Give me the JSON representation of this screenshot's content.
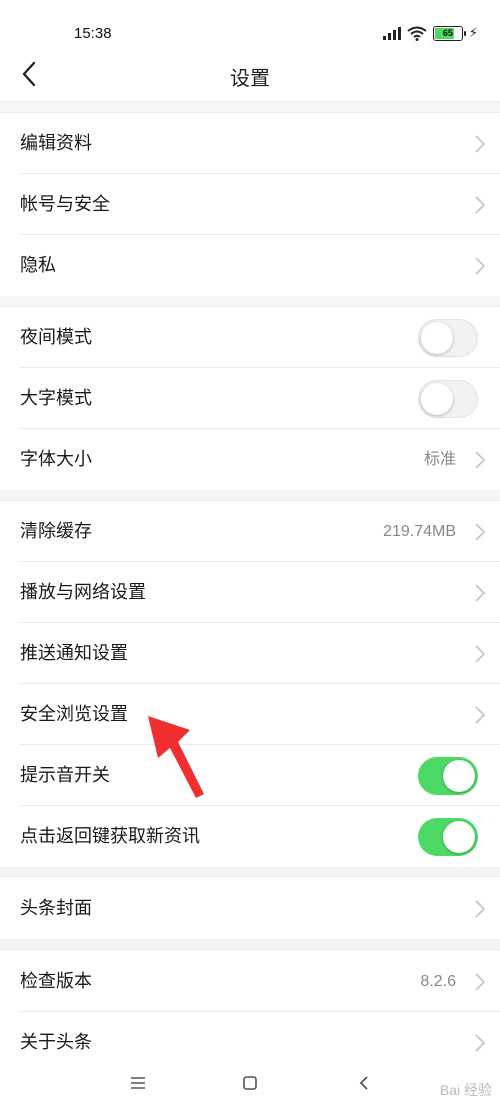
{
  "status": {
    "time": "15:38",
    "battery": "65"
  },
  "header": {
    "title": "设置"
  },
  "rows": [
    {
      "label": "编辑资料"
    },
    {
      "label": "帐号与安全"
    },
    {
      "label": "隐私"
    },
    {
      "label": "夜间模式",
      "toggle": "off"
    },
    {
      "label": "大字模式",
      "toggle": "off"
    },
    {
      "label": "字体大小",
      "value": "标准"
    },
    {
      "label": "清除缓存",
      "value": "219.74MB"
    },
    {
      "label": "播放与网络设置"
    },
    {
      "label": "推送通知设置"
    },
    {
      "label": "安全浏览设置"
    },
    {
      "label": "提示音开关",
      "toggle": "on"
    },
    {
      "label": "点击返回键获取新资讯",
      "toggle": "on"
    },
    {
      "label": "头条封面"
    },
    {
      "label": "检查版本",
      "value": "8.2.6"
    },
    {
      "label": "关于头条"
    }
  ],
  "colors": {
    "toggle_on": "#4cd964",
    "separator": "#f4f5f6",
    "annotation_arrow": "#f03030"
  },
  "watermark": "Bai 经验"
}
